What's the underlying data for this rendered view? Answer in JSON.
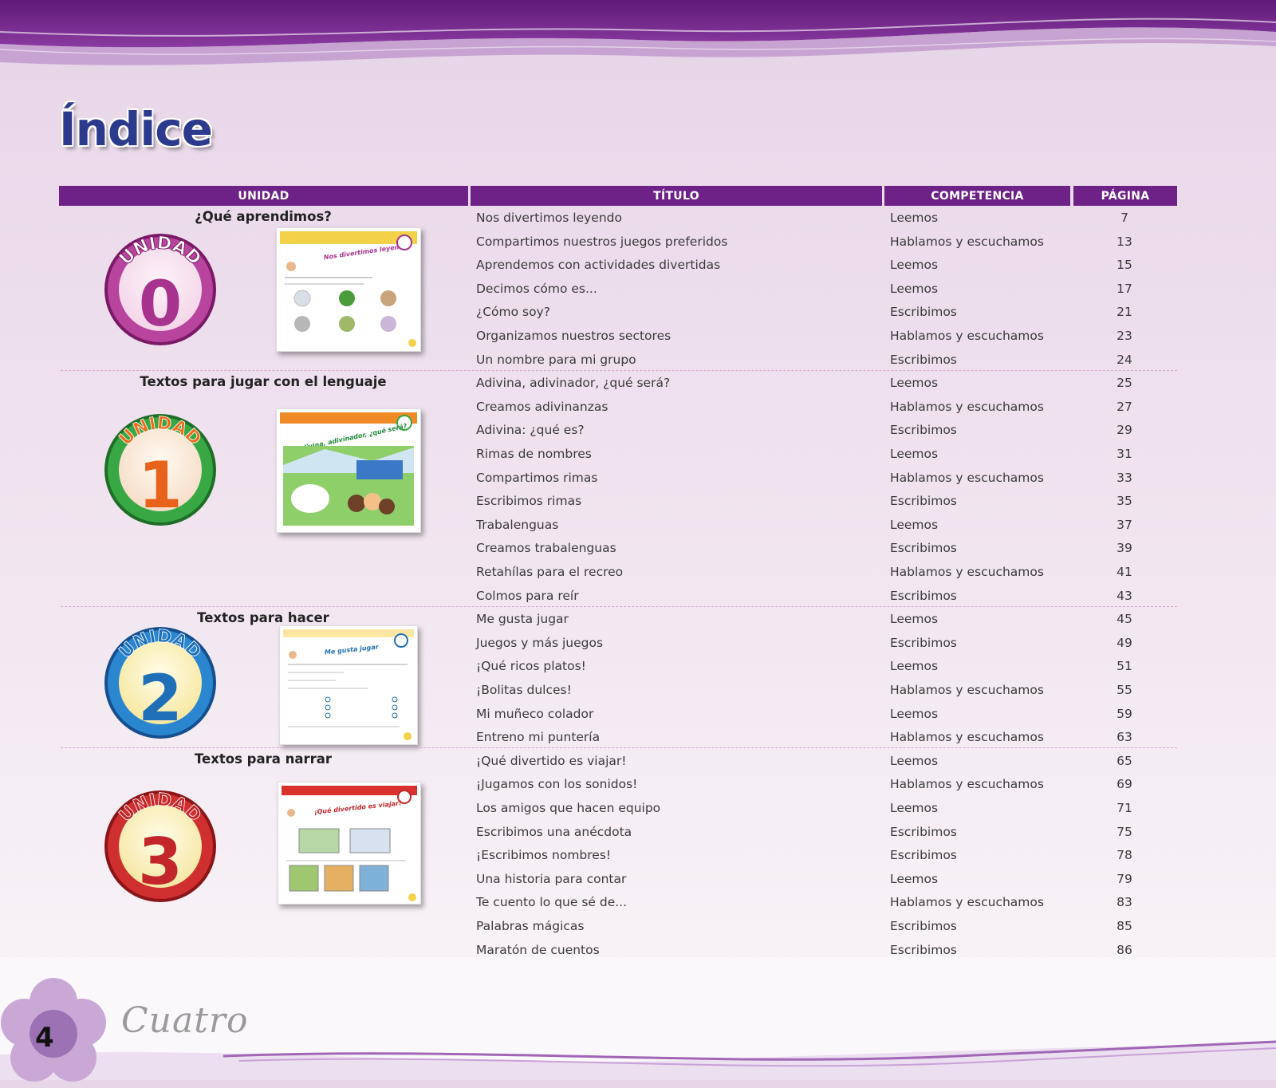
{
  "page": {
    "heading": "Índice",
    "page_number": "4",
    "page_word": "Cuatro"
  },
  "columns": [
    "UNIDAD",
    "TÍTULO",
    "COMPETENCIA",
    "PÁGINA"
  ],
  "units": [
    {
      "badge_word": "UNIDAD",
      "number": "0",
      "title": "¿Qué aprendimos?",
      "thumb_title": "Nos divertimos leyendo",
      "color": "#a8338f"
    },
    {
      "badge_word": "UNIDAD",
      "number": "1",
      "title": "Textos para jugar con el lenguaje",
      "thumb_title": "Adivina, adivinador, ¿qué será?",
      "color": "#2f9a3a"
    },
    {
      "badge_word": "UNIDAD",
      "number": "2",
      "title": "Textos para hacer",
      "thumb_title": "Me gusta jugar",
      "color": "#1f6fb8"
    },
    {
      "badge_word": "UNIDAD",
      "number": "3",
      "title": "Textos para narrar",
      "thumb_title": "¡Qué divertido es viajar!",
      "color": "#c2262a"
    }
  ],
  "rows": [
    {
      "title": "Nos divertimos leyendo",
      "competencia": "Leemos",
      "pagina": "7"
    },
    {
      "title": "Compartimos nuestros juegos preferidos",
      "competencia": "Hablamos y escuchamos",
      "pagina": "13"
    },
    {
      "title": "Aprendemos con actividades divertidas",
      "competencia": "Leemos",
      "pagina": "15"
    },
    {
      "title": "Decimos cómo es...",
      "competencia": "Leemos",
      "pagina": "17"
    },
    {
      "title": "¿Cómo soy?",
      "competencia": "Escribimos",
      "pagina": "21"
    },
    {
      "title": "Organizamos nuestros sectores",
      "competencia": "Hablamos y escuchamos",
      "pagina": "23"
    },
    {
      "title": "Un nombre para mi grupo",
      "competencia": "Escribimos",
      "pagina": "24"
    },
    {
      "title": "Adivina, adivinador, ¿qué será?",
      "competencia": "Leemos",
      "pagina": "25"
    },
    {
      "title": "Creamos adivinanzas",
      "competencia": "Hablamos y escuchamos",
      "pagina": "27"
    },
    {
      "title": "Adivina: ¿qué es?",
      "competencia": "Escribimos",
      "pagina": "29"
    },
    {
      "title": "Rimas de nombres",
      "competencia": "Leemos",
      "pagina": "31"
    },
    {
      "title": "Compartimos rimas",
      "competencia": "Hablamos y escuchamos",
      "pagina": "33"
    },
    {
      "title": "Escribimos rimas",
      "competencia": "Escribimos",
      "pagina": "35"
    },
    {
      "title": "Trabalenguas",
      "competencia": "Leemos",
      "pagina": "37"
    },
    {
      "title": "Creamos trabalenguas",
      "competencia": "Escribimos",
      "pagina": "39"
    },
    {
      "title": "Retahílas para el recreo",
      "competencia": "Hablamos y escuchamos",
      "pagina": "41"
    },
    {
      "title": "Colmos para reír",
      "competencia": "Escribimos",
      "pagina": "43"
    },
    {
      "title": "Me gusta jugar",
      "competencia": "Leemos",
      "pagina": "45"
    },
    {
      "title": "Juegos y más juegos",
      "competencia": "Escribimos",
      "pagina": "49"
    },
    {
      "title": "¡Qué ricos platos!",
      "competencia": "Leemos",
      "pagina": "51"
    },
    {
      "title": "¡Bolitas dulces!",
      "competencia": "Hablamos y escuchamos",
      "pagina": "55"
    },
    {
      "title": "Mi muñeco colador",
      "competencia": "Leemos",
      "pagina": "59"
    },
    {
      "title": "Entreno mi puntería",
      "competencia": "Hablamos y escuchamos",
      "pagina": "63"
    },
    {
      "title": "¡Qué divertido es viajar!",
      "competencia": "Leemos",
      "pagina": "65"
    },
    {
      "title": "¡Jugamos con los sonidos!",
      "competencia": "Hablamos y escuchamos",
      "pagina": "69"
    },
    {
      "title": "Los amigos que hacen equipo",
      "competencia": "Leemos",
      "pagina": "71"
    },
    {
      "title": "Escribimos una anécdota",
      "competencia": "Escribimos",
      "pagina": "75"
    },
    {
      "title": "¡Escribimos nombres!",
      "competencia": "Escribimos",
      "pagina": "78"
    },
    {
      "title": "Una historia para contar",
      "competencia": "Leemos",
      "pagina": "79"
    },
    {
      "title": "Te cuento lo que sé de...",
      "competencia": "Hablamos y escuchamos",
      "pagina": "83"
    },
    {
      "title": "Palabras mágicas",
      "competencia": "Escribimos",
      "pagina": "85"
    },
    {
      "title": "Maratón de cuentos",
      "competencia": "Escribimos",
      "pagina": "86"
    }
  ]
}
